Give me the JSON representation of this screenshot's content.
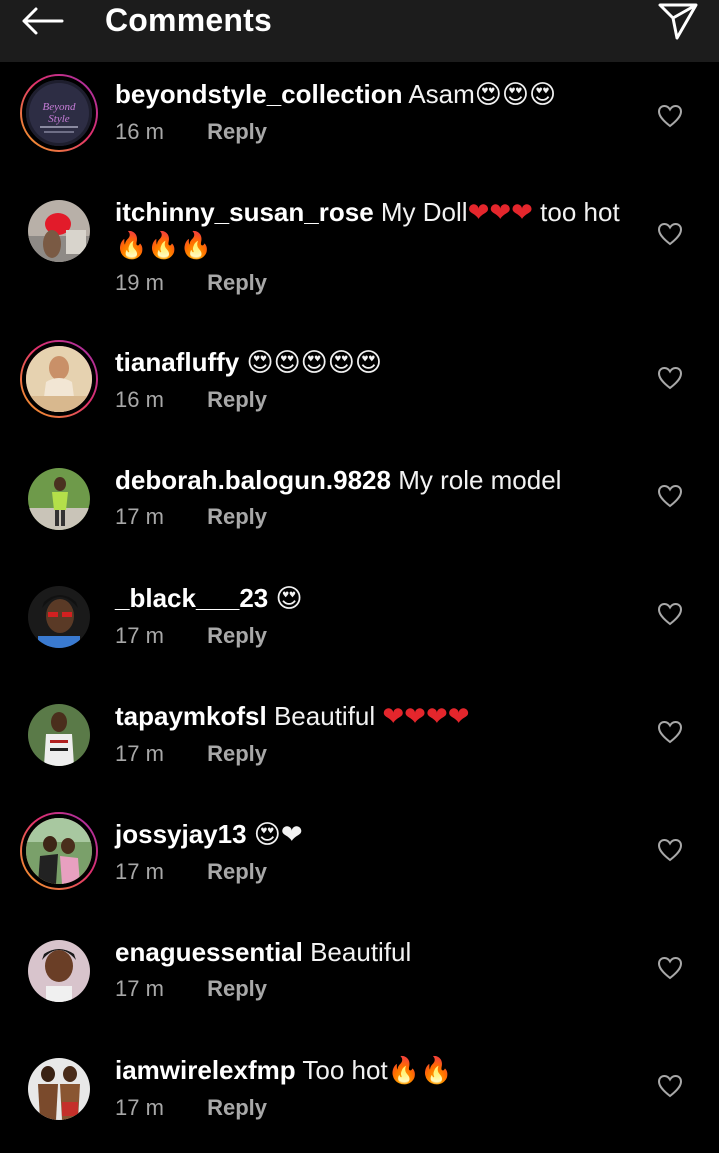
{
  "header": {
    "title": "Comments",
    "back_icon": "arrow-left-icon",
    "share_icon": "paper-plane-icon"
  },
  "colors": {
    "background": "#000000",
    "header_bg": "#1c1c1c",
    "meta_text": "#a8a8a8",
    "heart_red": "#e4262c",
    "emoji_yellow": "#ffcc33"
  },
  "comments": [
    {
      "username": "beyondstyle_collection",
      "text": "Asam",
      "emoji": [
        "heart-eyes",
        "heart-eyes",
        "heart-eyes"
      ],
      "emoji_text": "😍😍😍",
      "time": "16 m",
      "reply": "Reply",
      "story": true
    },
    {
      "username": "itchinny_susan_rose",
      "text": "My Doll",
      "emoji_text": "❤❤❤",
      "text2": "too hot",
      "emoji_text2": "🔥🔥🔥",
      "time": "19 m",
      "reply": "Reply",
      "story": false
    },
    {
      "username": "tianafluffy",
      "text": "",
      "emoji_text": "😍😍😍😍😍",
      "time": "16 m",
      "reply": "Reply",
      "story": true
    },
    {
      "username": "deborah.balogun.9828",
      "text": "My role model",
      "emoji_text": "",
      "time": "17 m",
      "reply": "Reply",
      "story": false
    },
    {
      "username": "_black___23",
      "text": "",
      "emoji_text": "😍",
      "time": "17 m",
      "reply": "Reply",
      "story": false
    },
    {
      "username": "tapaymkofsl",
      "text": "Beautiful",
      "emoji_text": "❤❤❤❤",
      "time": "17 m",
      "reply": "Reply",
      "story": false
    },
    {
      "username": "jossyjay13",
      "text": "",
      "emoji_text": "😍❤",
      "time": "17 m",
      "reply": "Reply",
      "story": true
    },
    {
      "username": "enaguessential",
      "text": "Beautiful",
      "emoji_text": "",
      "time": "17 m",
      "reply": "Reply",
      "story": false
    },
    {
      "username": "iamwirelexfmp",
      "text": "Too hot",
      "emoji_text": "🔥🔥",
      "time": "17 m",
      "reply": "Reply",
      "story": false
    }
  ],
  "avatar_logo_text": "BeyondStyle"
}
